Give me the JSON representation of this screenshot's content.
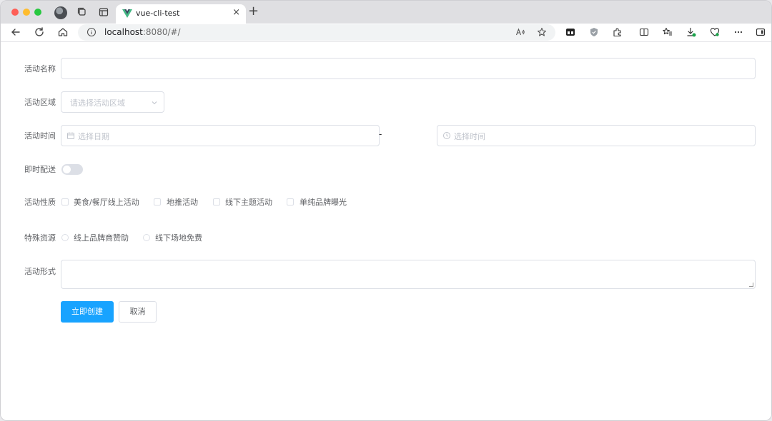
{
  "browser": {
    "tab_title": "vue-cli-test",
    "tab_close": "×",
    "new_tab": "+",
    "address_host": "localhost",
    "address_path": ":8080/#/"
  },
  "form": {
    "name_label": "活动名称",
    "name_value": "",
    "region_label": "活动区域",
    "region_placeholder": "请选择活动区域",
    "time_label": "活动时间",
    "date_placeholder": "选择日期",
    "range_separator": "-",
    "time_placeholder": "选择时间",
    "delivery_label": "即时配送",
    "delivery_on": false,
    "type_label": "活动性质",
    "type_options": [
      "美食/餐厅线上活动",
      "地推活动",
      "线下主题活动",
      "单纯品牌曝光"
    ],
    "resource_label": "特殊资源",
    "resource_options": [
      "线上品牌商赞助",
      "线下场地免费"
    ],
    "desc_label": "活动形式",
    "desc_value": "",
    "submit_label": "立即创建",
    "cancel_label": "取消"
  },
  "colors": {
    "primary": "#18a3ff",
    "border": "#dcdfe6",
    "placeholder": "#c0c4cc",
    "label": "#606266"
  }
}
